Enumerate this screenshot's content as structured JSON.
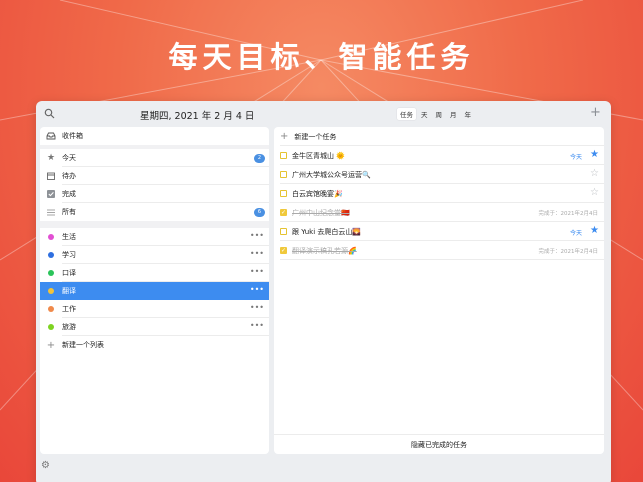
{
  "headline": "每天目标、智能任务",
  "topbar": {
    "date": "星期四, 2021 年 2 月 4 日",
    "tabs": [
      "任务",
      "天",
      "周",
      "月",
      "年"
    ],
    "add_symbol": "+"
  },
  "sidebar": {
    "inbox": "收件箱",
    "smart_lists": [
      {
        "label": "今天",
        "icon": "star-icon",
        "badge": "2"
      },
      {
        "label": "待办",
        "icon": "calendar-icon",
        "badge": ""
      },
      {
        "label": "完成",
        "icon": "checkbox-icon",
        "badge": ""
      },
      {
        "label": "所有",
        "icon": "list-icon",
        "badge": "6"
      }
    ],
    "lists": [
      {
        "label": "生活",
        "color": "#e24fd3"
      },
      {
        "label": "学习",
        "color": "#2f6fe0"
      },
      {
        "label": "口译",
        "color": "#2bc45a"
      },
      {
        "label": "翻译",
        "color": "#f2c33a",
        "selected": true
      },
      {
        "label": "工作",
        "color": "#f08a4b"
      },
      {
        "label": "旅游",
        "color": "#7ed321"
      }
    ],
    "more_symbol": "•••",
    "new_list": "新建一个列表"
  },
  "tasks": {
    "new_task": "新建一个任务",
    "items": [
      {
        "title": "金牛区青城山 🌞",
        "due": "今天",
        "done_text": "",
        "starred": true,
        "completed": false
      },
      {
        "title": "广州大学城公众号运营🔍",
        "due": "",
        "done_text": "",
        "starred": false,
        "completed": false
      },
      {
        "title": "白云宾馆晚宴🎉",
        "due": "",
        "done_text": "",
        "starred": false,
        "completed": false
      },
      {
        "title": "广州中山纪念堂🇨🇳",
        "due": "",
        "done_text": "完成于：2021年2月4日",
        "starred": false,
        "completed": true
      },
      {
        "title": "跟 Yuki 去爬白云山🌄",
        "due": "今天",
        "done_text": "",
        "starred": true,
        "completed": false
      },
      {
        "title": "翻译演示稿孔若源🌈",
        "due": "",
        "done_text": "完成于：2021年2月4日",
        "starred": false,
        "completed": true
      }
    ],
    "hide_completed": "隐藏已完成的任务"
  }
}
